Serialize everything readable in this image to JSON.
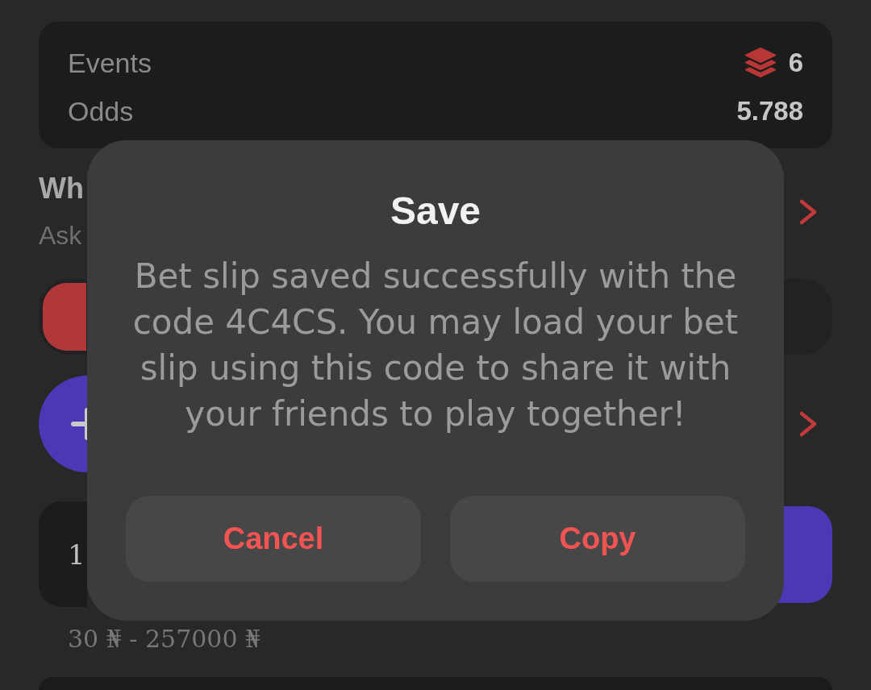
{
  "summary": {
    "events_label": "Events",
    "events_count": "6",
    "odds_label": "Odds",
    "odds_value": "5.788"
  },
  "section": {
    "title": "Wh",
    "subtitle": "Ask"
  },
  "mode_toggle": {
    "segments": [
      {
        "selected": true
      }
    ]
  },
  "stake": {
    "value": "1",
    "range": "30 ₦ - 257000 ₦"
  },
  "dialog": {
    "title": "Save",
    "message": "Bet slip saved successfully with the code 4C4CS. You may load your bet slip using this code to share it with your friends to play together!",
    "buttons": [
      {
        "label": "Cancel"
      },
      {
        "label": "Copy"
      }
    ]
  }
}
